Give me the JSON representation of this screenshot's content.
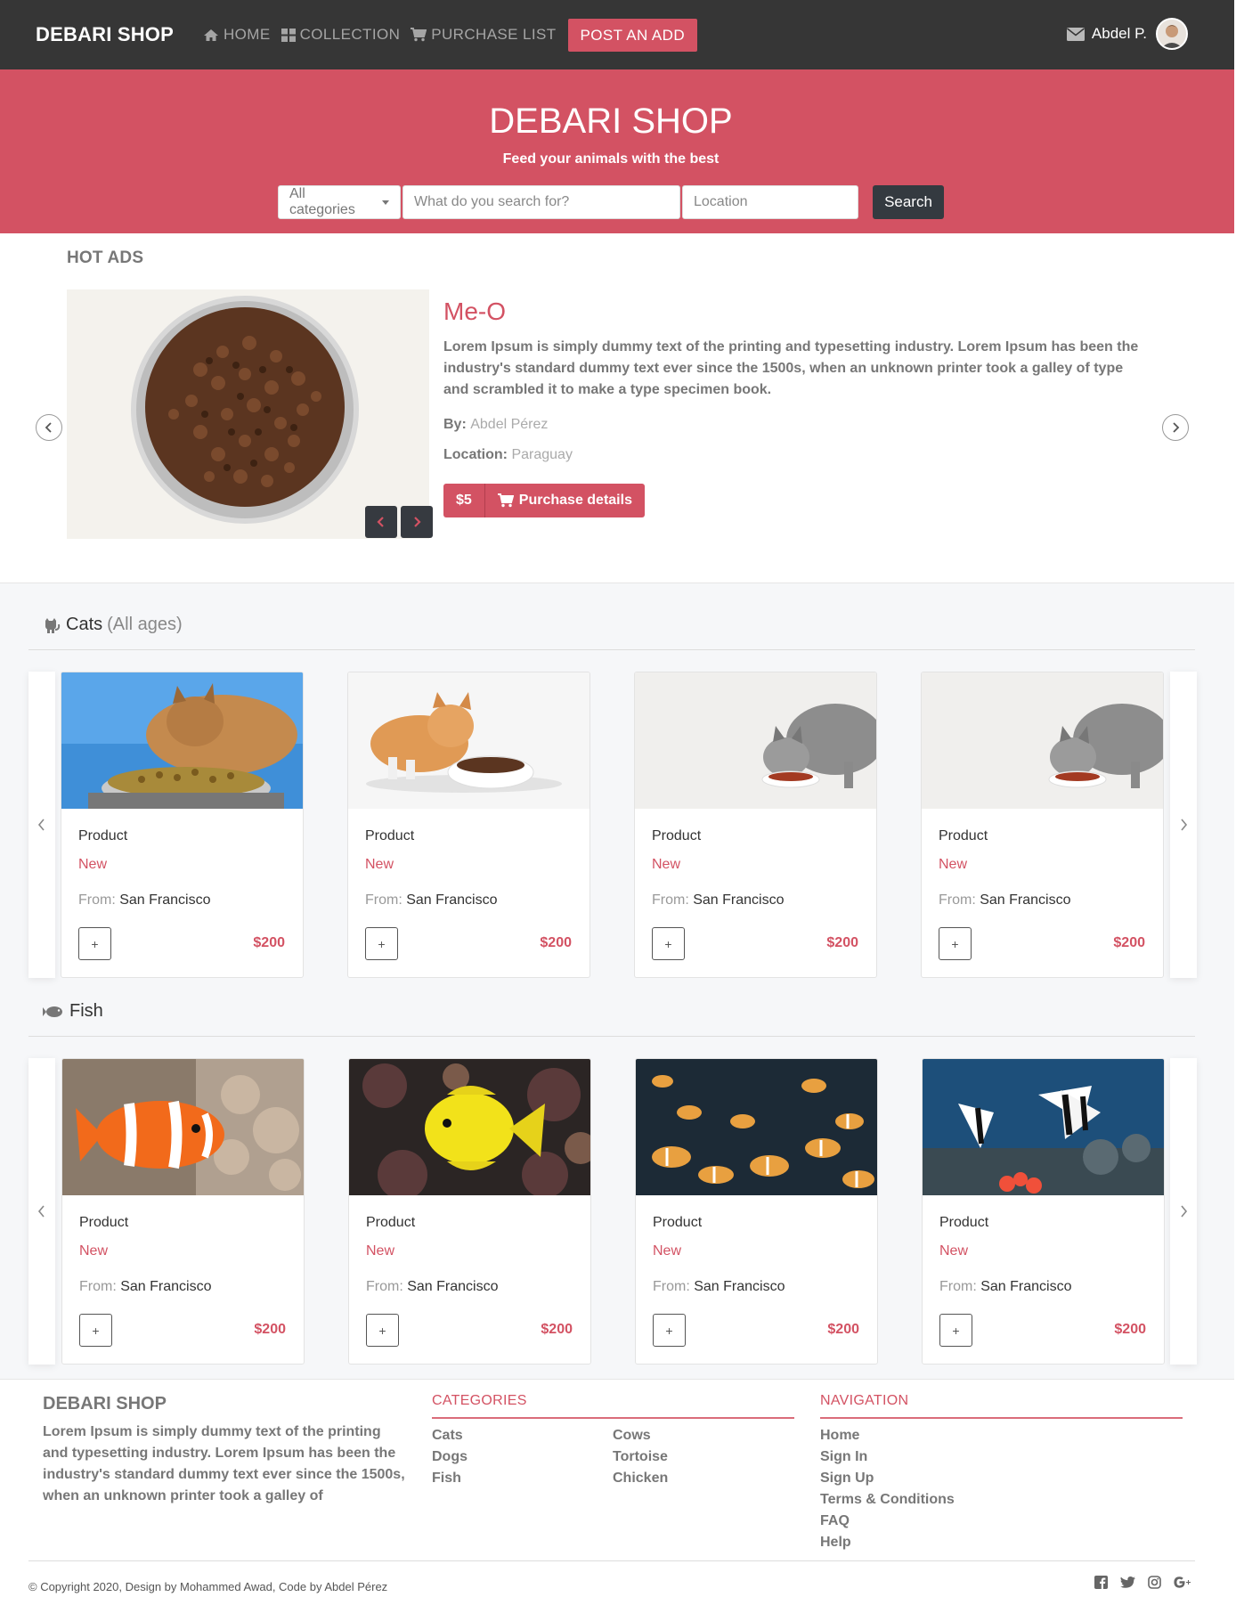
{
  "navbar": {
    "brand": "DEBARI SHOP",
    "links": [
      {
        "label": "HOME",
        "icon": "home-icon"
      },
      {
        "label": "COLLECTION",
        "icon": "grid-icon"
      },
      {
        "label": "PURCHASE LIST",
        "icon": "cart-icon"
      }
    ],
    "post_label": "POST AN ADD",
    "user_name": "Abdel P."
  },
  "hero": {
    "title": "DEBARI SHOP",
    "subtitle": "Feed your animals with the best",
    "category_select": "All categories",
    "search_placeholder": "What do you search for?",
    "location_placeholder": "Location",
    "search_button": "Search"
  },
  "hot_ads": {
    "title": "HOT ADS",
    "name": "Me-O",
    "description": "Lorem Ipsum is simply dummy text of the printing and typesetting industry. Lorem Ipsum has been the industry's standard dummy text ever since the 1500s, when an unknown printer took a galley of type and scrambled it to make a type specimen book.",
    "by_label": "By:",
    "by_value": "Abdel Pérez",
    "location_label": "Location:",
    "location_value": "Paraguay",
    "price": "$5",
    "details_label": "Purchase details"
  },
  "sections": [
    {
      "title": "Cats",
      "subtitle": "(All ages)",
      "icon": "cat-icon",
      "cards": [
        {
          "name": "Product",
          "status": "New",
          "from_label": "From:",
          "city": "San Francisco",
          "price": "$200",
          "plus": "+"
        },
        {
          "name": "Product",
          "status": "New",
          "from_label": "From:",
          "city": "San Francisco",
          "price": "$200",
          "plus": "+"
        },
        {
          "name": "Product",
          "status": "New",
          "from_label": "From:",
          "city": "San Francisco",
          "price": "$200",
          "plus": "+"
        },
        {
          "name": "Product",
          "status": "New",
          "from_label": "From:",
          "city": "San Francisco",
          "price": "$200",
          "plus": "+"
        }
      ]
    },
    {
      "title": "Fish",
      "subtitle": "",
      "icon": "fish-icon",
      "cards": [
        {
          "name": "Product",
          "status": "New",
          "from_label": "From:",
          "city": "San Francisco",
          "price": "$200",
          "plus": "+"
        },
        {
          "name": "Product",
          "status": "New",
          "from_label": "From:",
          "city": "San Francisco",
          "price": "$200",
          "plus": "+"
        },
        {
          "name": "Product",
          "status": "New",
          "from_label": "From:",
          "city": "San Francisco",
          "price": "$200",
          "plus": "+"
        },
        {
          "name": "Product",
          "status": "New",
          "from_label": "From:",
          "city": "San Francisco",
          "price": "$200",
          "plus": "+"
        }
      ]
    }
  ],
  "footer": {
    "brand": "DEBARI SHOP",
    "description": "Lorem Ipsum is simply dummy text of the printing and typesetting industry. Lorem Ipsum has been the industry's standard dummy text ever since the 1500s, when an unknown printer took a galley of",
    "categories_title": "CATEGORIES",
    "categories_col1": [
      "Cats",
      "Dogs",
      "Fish"
    ],
    "categories_col2": [
      "Cows",
      "Tortoise",
      "Chicken"
    ],
    "navigation_title": "NAVIGATION",
    "navigation": [
      "Home",
      "Sign In",
      "Sign Up",
      "Terms & Conditions",
      "FAQ",
      "Help"
    ],
    "copyright": "© Copyright 2020, Design by Mohammed Awad, Code by Abdel Pérez",
    "socials": [
      "facebook-icon",
      "twitter-icon",
      "instagram-icon",
      "google-plus-icon"
    ]
  },
  "colors": {
    "brand": "#d35263",
    "navbar": "#363636",
    "dark_button": "#343a40"
  }
}
